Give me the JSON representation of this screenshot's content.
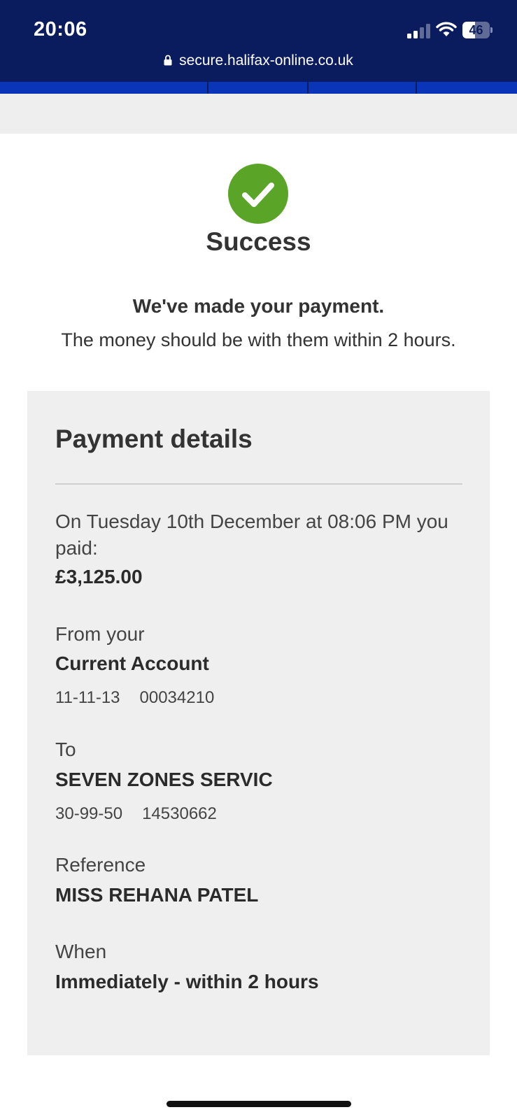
{
  "status_bar": {
    "time": "20:06",
    "battery_level": "46"
  },
  "browser": {
    "url": "secure.halifax-online.co.uk"
  },
  "success": {
    "title": "Success",
    "headline": "We've made your payment.",
    "note": "The money should be with them within 2 hours."
  },
  "details": {
    "title": "Payment details",
    "paid_label": "On Tuesday 10th December at 08:06 PM you paid:",
    "amount": "£3,125.00",
    "from_label": "From your",
    "from_account": "Current Account",
    "from_sort_code": "11-11-13",
    "from_account_number": "00034210",
    "to_label": "To",
    "to_name": "SEVEN ZONES SERVIC",
    "to_sort_code": "30-99-50",
    "to_account_number": "14530662",
    "reference_label": "Reference",
    "reference": "MISS REHANA PATEL",
    "when_label": "When",
    "when": "Immediately - within 2 hours"
  },
  "colors": {
    "header_navy": "#0b1c5e",
    "nav_blue": "#0a35b8",
    "success_green": "#5aa528",
    "card_grey": "#efefef"
  }
}
